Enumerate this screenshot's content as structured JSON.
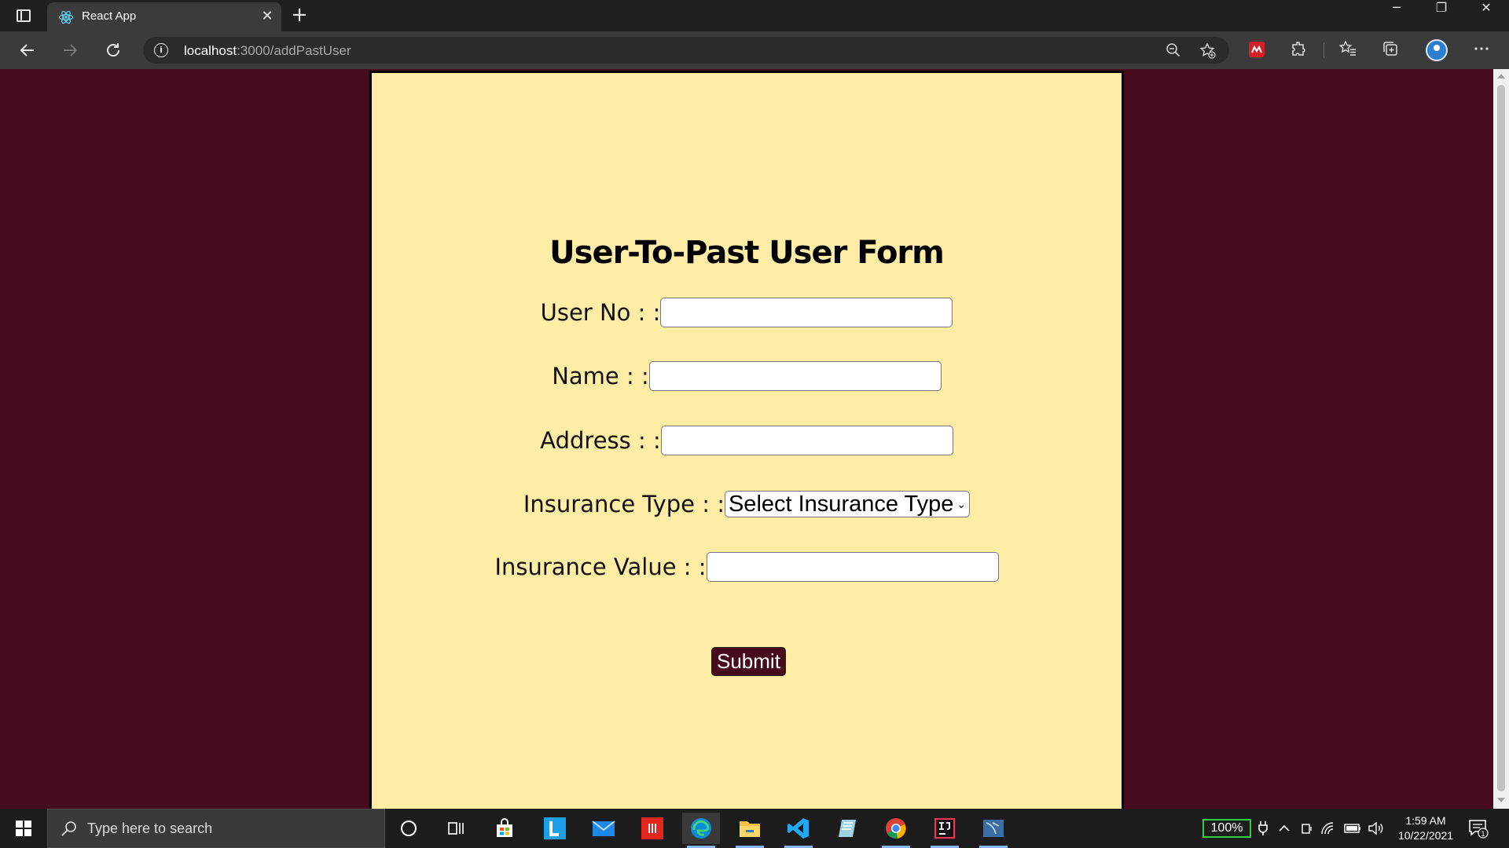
{
  "browser": {
    "tab_title": "React App",
    "url_host": "localhost",
    "url_rest": ":3000/addPastUser",
    "tab_close_glyph": "✕",
    "new_tab_glyph": "+",
    "icons": [
      "tab-actions-icon",
      "react-favicon",
      "back-icon",
      "forward-icon",
      "refresh-icon",
      "info-icon",
      "zoom-out-icon",
      "add-favorite-icon",
      "extension-red-icon",
      "extensions-icon",
      "favorites-icon",
      "collections-icon",
      "profile-avatar",
      "more-icon"
    ]
  },
  "window_controls": {
    "minimize": "─",
    "maximize": "❐",
    "close": "✕"
  },
  "form": {
    "title": "User-To-Past User Form",
    "user_no_label": "User No : :",
    "name_label": "Name : :",
    "address_label": "Address : :",
    "insurance_type_label": "Insurance Type : :",
    "insurance_type_selected": "Select Insurance Type",
    "insurance_value_label": "Insurance Value : :",
    "user_no_value": "",
    "name_value": "",
    "address_value": "",
    "insurance_value_value": "",
    "submit_label": "Submit"
  },
  "colors": {
    "page_background": "#470b1e",
    "card_background": "#ffeda5",
    "button_background": "#470b1e",
    "battery_border": "#2ecc40"
  },
  "taskbar": {
    "search_placeholder": "Type here to search",
    "battery": "100%",
    "time": "1:59 AM",
    "date": "10/22/2021",
    "notification_count": "1",
    "apps": [
      "cortana-icon",
      "task-view-icon",
      "store-icon",
      "l-app-icon",
      "mail-icon",
      "red-app-icon",
      "edge-icon",
      "file-explorer-icon",
      "vscode-icon",
      "notes-app-icon",
      "chrome-icon",
      "intellij-icon",
      "sql-tool-icon"
    ]
  }
}
